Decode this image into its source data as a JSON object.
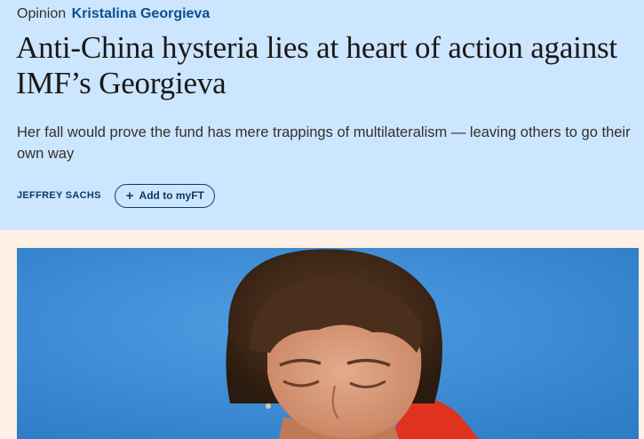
{
  "article": {
    "section_label": "Opinion",
    "topic_label": "Kristalina Georgieva",
    "headline": "Anti-China hysteria lies at heart of action against IMF’s Georgieva",
    "standfirst": "Her fall would prove the fund has mere trappings of multilateralism — leaving others to go their own way",
    "author": "JEFFREY SACHS",
    "myft": {
      "icon": "plus-icon",
      "label": "Add to myFT"
    }
  },
  "colors": {
    "header_background": "#cce6ff",
    "page_background": "#fff1e5",
    "topic_link": "#0d4f8f",
    "accent": "#0d3a66"
  },
  "image": {
    "subject": "photo of a woman with short brown hair looking down against a blue background"
  }
}
